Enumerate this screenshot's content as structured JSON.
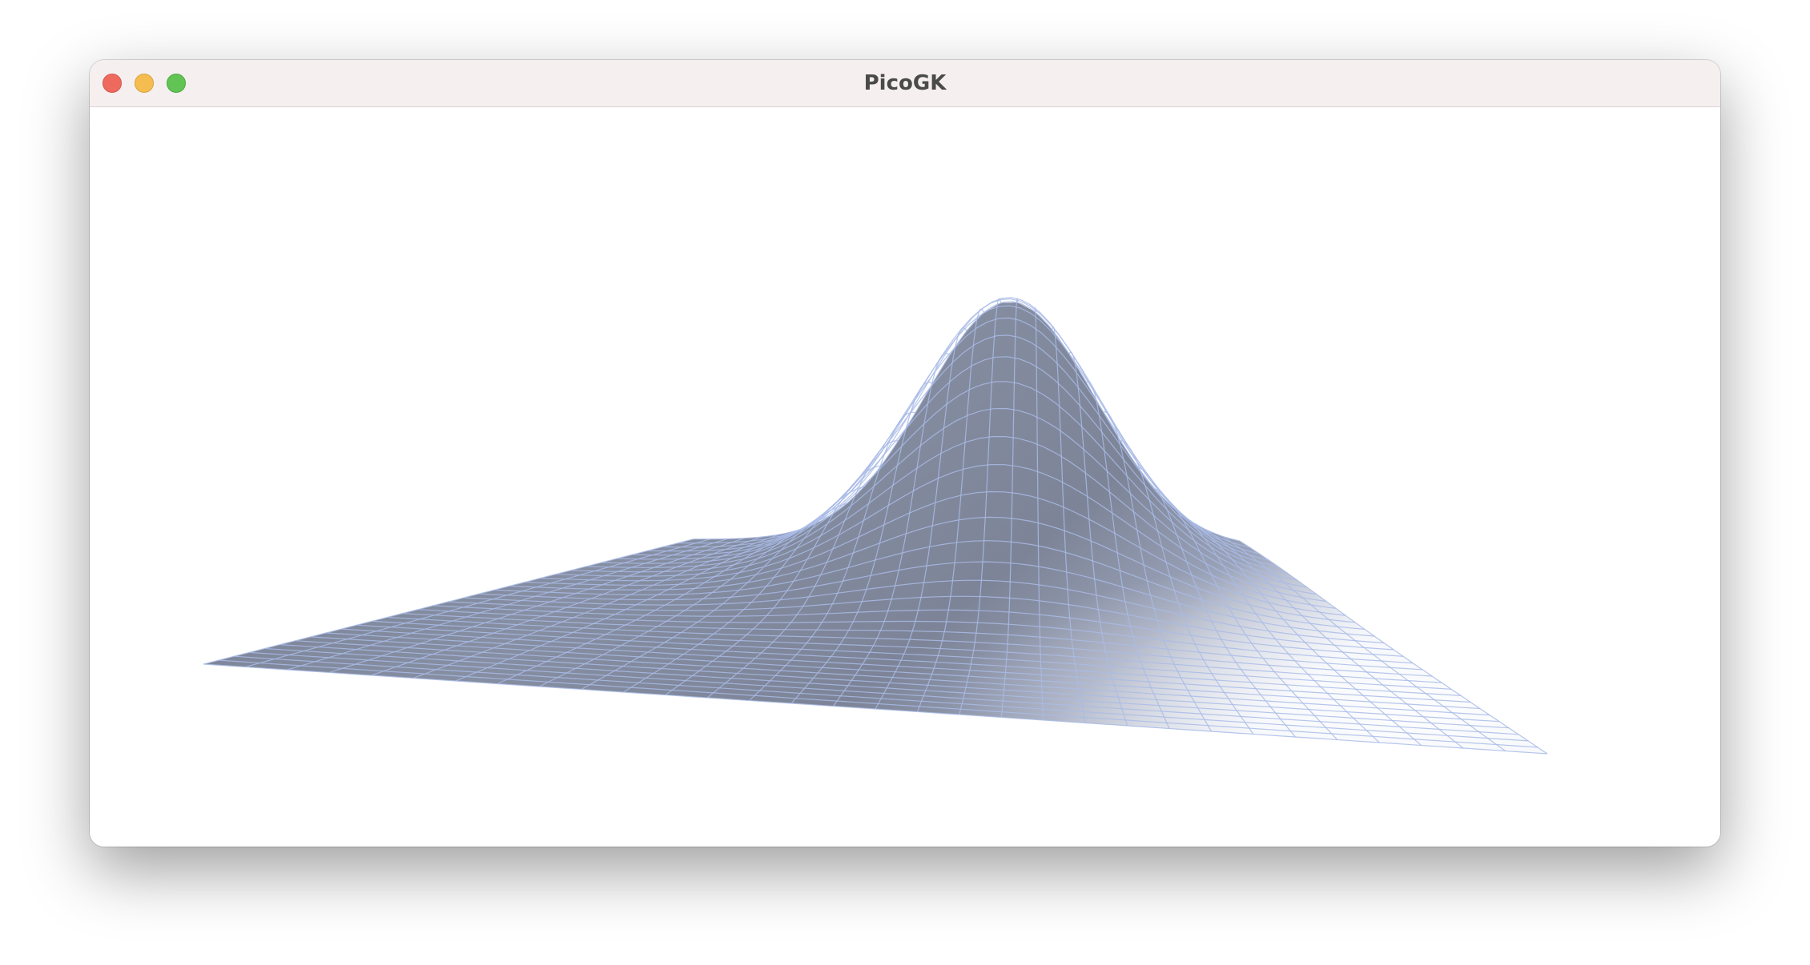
{
  "window": {
    "title": "PicoGK"
  },
  "colors": {
    "titlebar": "#f5efef",
    "close": "#ee6a5f",
    "minimize": "#f5bd4f",
    "maximize": "#61c454",
    "surface_dark": "#7c8396",
    "surface_light": "#eceff7",
    "wire": "#a9bbe6"
  },
  "icons": {
    "close": "close-icon",
    "minimize": "minimize-icon",
    "maximize": "maximize-icon"
  }
}
